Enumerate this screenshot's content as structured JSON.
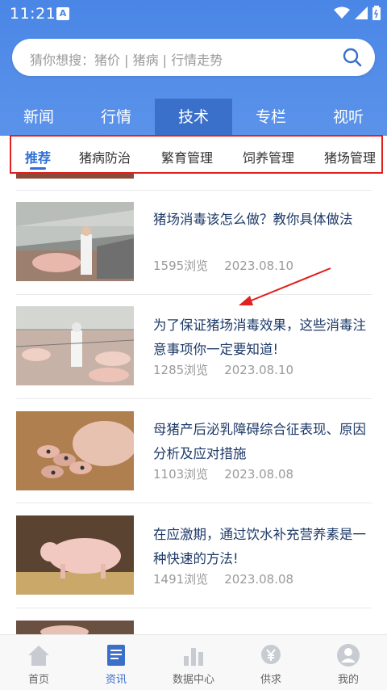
{
  "status_bar": {
    "time": "11:21",
    "notification_icon": "A"
  },
  "search": {
    "placeholder": "猜你想搜：猪价 | 猪病 | 行情走势"
  },
  "main_tabs": [
    {
      "label": "新闻",
      "active": false
    },
    {
      "label": "行情",
      "active": false
    },
    {
      "label": "技术",
      "active": true
    },
    {
      "label": "专栏",
      "active": false
    },
    {
      "label": "视听",
      "active": false
    }
  ],
  "sub_tabs": [
    {
      "label": "推荐",
      "active": true
    },
    {
      "label": "猪病防治",
      "active": false
    },
    {
      "label": "繁育管理",
      "active": false
    },
    {
      "label": "饲养管理",
      "active": false
    },
    {
      "label": "猪场管理",
      "active": false
    }
  ],
  "articles": [
    {
      "title": "猪场消毒该怎么做？教你具体做法",
      "views": "1595浏览",
      "date": "2023.08.10",
      "thumb": "pig-barn-disinfection-spray"
    },
    {
      "title": "为了保证猪场消毒效果，这些消毒注意事项你一定要知道!",
      "views": "1285浏览",
      "date": "2023.08.10",
      "thumb": "worker-in-pig-pens"
    },
    {
      "title": "母猪产后泌乳障碍综合征表现、原因分析及应对措施",
      "views": "1103浏览",
      "date": "2023.08.08",
      "thumb": "sow-with-piglets"
    },
    {
      "title": "在应激期，通过饮水补充营养素是一种快速的方法!",
      "views": "1491浏览",
      "date": "2023.08.08",
      "thumb": "pig-on-straw"
    },
    {
      "title": "",
      "views": "",
      "date": "",
      "thumb": "pigs-partial"
    }
  ],
  "bottom_nav": [
    {
      "label": "首页",
      "icon": "home-icon",
      "active": false
    },
    {
      "label": "资讯",
      "icon": "news-icon",
      "active": true
    },
    {
      "label": "数据中心",
      "icon": "chart-icon",
      "active": false
    },
    {
      "label": "供求",
      "icon": "yen-icon",
      "active": false
    },
    {
      "label": "我的",
      "icon": "user-icon",
      "active": false
    }
  ],
  "colors": {
    "primary": "#4a86e6",
    "active_tab": "#3a6fca",
    "highlight_box": "#e0211d",
    "title_text": "#1e3a68"
  }
}
